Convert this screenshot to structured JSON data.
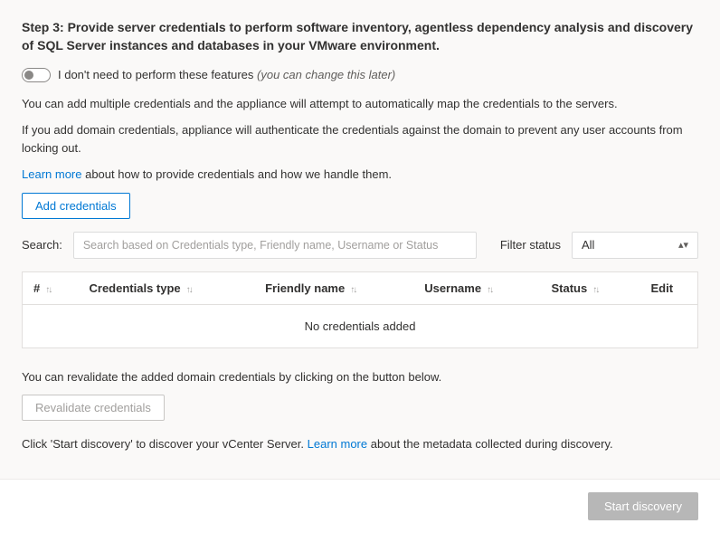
{
  "step": {
    "title": "Step 3: Provide server credentials to perform software inventory, agentless dependency analysis and discovery of SQL Server instances and databases in your VMware environment."
  },
  "toggle": {
    "label": "I don't need to perform these features",
    "hint": "(you can change this later)"
  },
  "intro": {
    "line1": "You can add multiple credentials and the appliance will attempt to automatically map the credentials to the servers.",
    "line2": "If you add domain credentials, appliance will authenticate the credentials against  the domain to prevent any user accounts from locking out.",
    "learn_more": "Learn more",
    "learn_more_rest": " about how to provide credentials and how we handle them."
  },
  "buttons": {
    "add_credentials": "Add credentials",
    "revalidate": "Revalidate credentials",
    "start_discovery": "Start discovery"
  },
  "search": {
    "label": "Search:",
    "placeholder": "Search based on Credentials type, Friendly name, Username or Status"
  },
  "filter": {
    "label": "Filter status",
    "selected": "All"
  },
  "table": {
    "headers": {
      "num": "#",
      "type": "Credentials type",
      "friendly": "Friendly name",
      "user": "Username",
      "status": "Status",
      "edit": "Edit"
    },
    "empty": "No credentials added"
  },
  "revalidate": {
    "note": "You can revalidate the added domain credentials by clicking on the button below."
  },
  "discovery": {
    "pre": "Click 'Start discovery' to discover your vCenter Server. ",
    "link": "Learn more",
    "post": " about the metadata collected during discovery."
  }
}
